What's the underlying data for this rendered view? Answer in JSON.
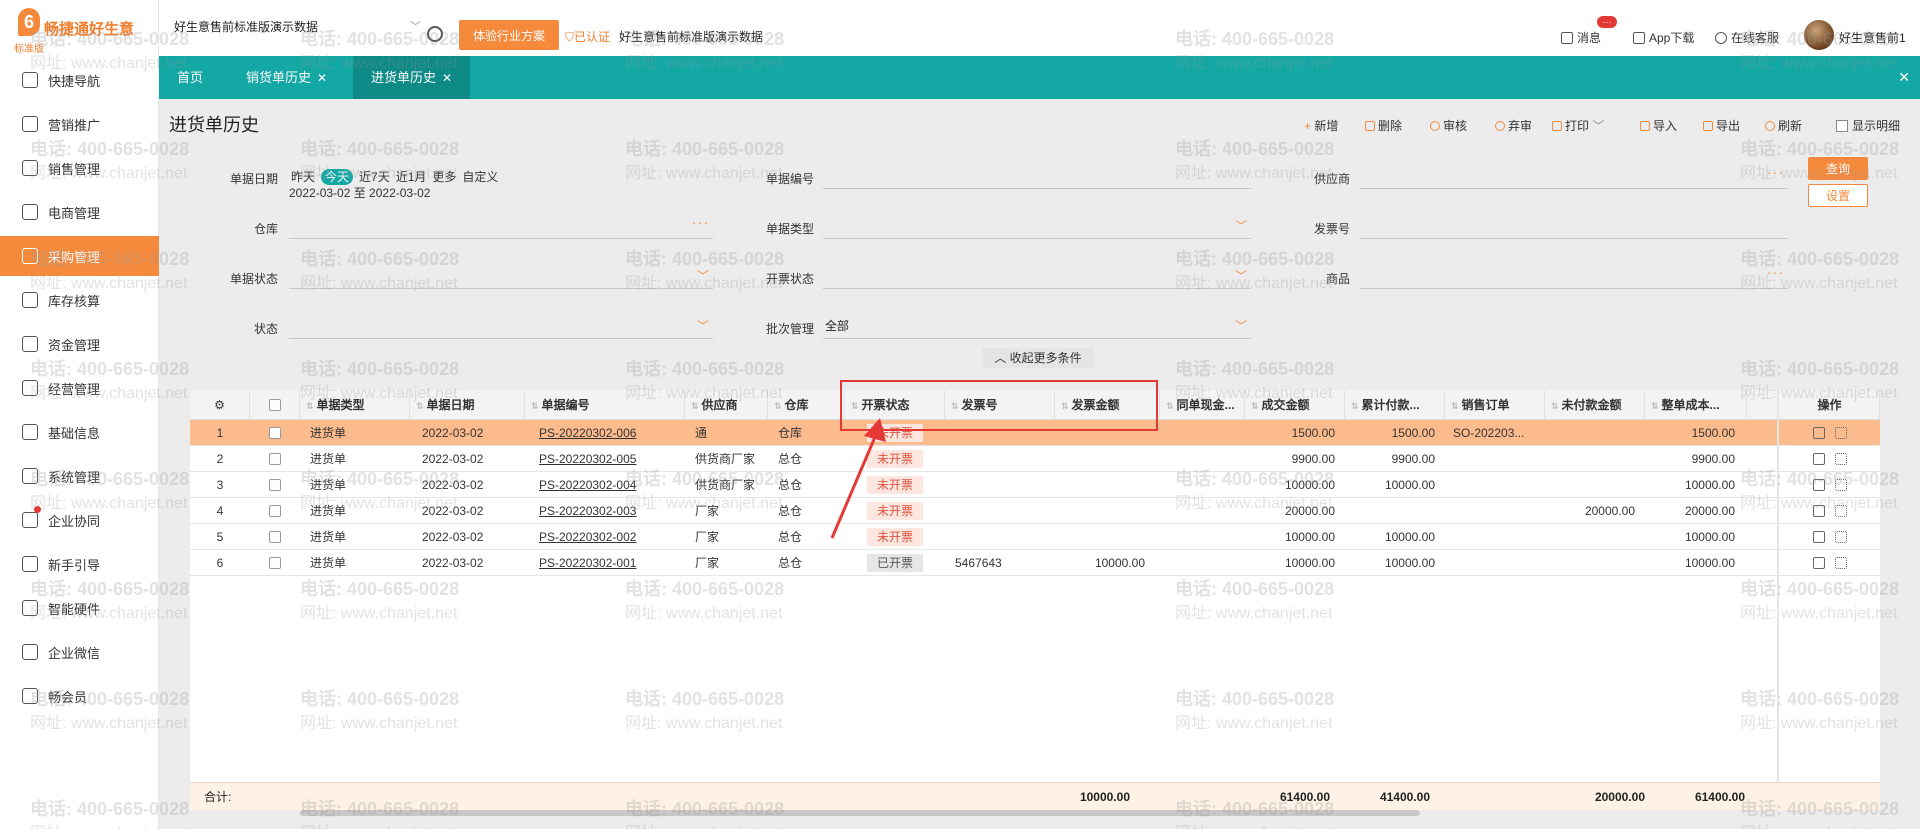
{
  "logo": {
    "brand": "畅捷通好生意",
    "edition": "标准版"
  },
  "sidebar": {
    "items": [
      {
        "label": "快捷导航",
        "icon": "compass-icon"
      },
      {
        "label": "营销推广",
        "icon": "gift-icon"
      },
      {
        "label": "销售管理",
        "icon": "tag-icon"
      },
      {
        "label": "电商管理",
        "icon": "store-icon"
      },
      {
        "label": "采购管理",
        "icon": "bag-icon",
        "active": true
      },
      {
        "label": "库存核算",
        "icon": "warehouse-icon"
      },
      {
        "label": "资金管理",
        "icon": "money-icon"
      },
      {
        "label": "经营管理",
        "icon": "clipboard-icon"
      },
      {
        "label": "基础信息",
        "icon": "id-card-icon"
      },
      {
        "label": "系统管理",
        "icon": "settings-icon"
      },
      {
        "label": "企业协同",
        "icon": "collab-icon",
        "badge": true
      },
      {
        "label": "新手引导",
        "icon": "guide-icon"
      },
      {
        "label": "智能硬件",
        "icon": "device-icon"
      },
      {
        "label": "企业微信",
        "icon": "wechat-icon"
      },
      {
        "label": "畅会员",
        "icon": "vip-icon"
      }
    ]
  },
  "topbar": {
    "account_name": "好生意售前标准版演示数据",
    "trial_button": "体验行业方案",
    "verified": "已认证",
    "company": "好生意售前标准版演示数据",
    "message": "消息",
    "message_badge": "···",
    "app_download": "App下载",
    "support": "在线客服",
    "username": "好生意售前1"
  },
  "tabs": [
    {
      "label": "首页",
      "closable": false
    },
    {
      "label": "销货单历史",
      "closable": true
    },
    {
      "label": "进货单历史",
      "closable": true,
      "active": true
    }
  ],
  "page": {
    "title": "进货单历史",
    "toolbar": {
      "add": "新增",
      "delete": "删除",
      "approve": "审核",
      "discard": "弃审",
      "print": "打印",
      "import": "导入",
      "export": "导出",
      "refresh": "刷新",
      "show_detail": "显示明细"
    }
  },
  "filter": {
    "doc_date_label": "单据日期",
    "quick_dates": [
      "昨天",
      "今天",
      "近7天",
      "近1月",
      "更多",
      "自定义"
    ],
    "quick_active": 1,
    "date_range": "2022-03-02 至 2022-03-02",
    "doc_no_label": "单据编号",
    "supplier_label": "供应商",
    "warehouse_label": "仓库",
    "doc_type_label": "单据类型",
    "invoice_no_label": "发票号",
    "doc_status_label": "单据状态",
    "invoice_status_label": "开票状态",
    "product_label": "商品",
    "status_label": "状态",
    "batch_label": "批次管理",
    "batch_value": "全部",
    "query": "查询",
    "settings": "设置",
    "collapse": "收起更多条件"
  },
  "grid": {
    "columns": [
      "单据类型",
      "单据日期",
      "单据编号",
      "供应商",
      "仓库",
      "开票状态",
      "发票号",
      "发票金额",
      "同单现金...",
      "成交金额",
      "累计付款...",
      "销售订单",
      "未付款金额",
      "整单成本...",
      "操作"
    ],
    "rows": [
      {
        "no": "1",
        "type": "进货单",
        "date": "2022-03-02",
        "code": "PS-20220302-006",
        "supplier": "通",
        "warehouse": "仓库",
        "invoice_status": "未开票",
        "invoice_no": "",
        "invoice_amt": "",
        "cash": "",
        "deal": "1500.00",
        "paid": "1500.00",
        "so": "SO-202203...",
        "unpaid": "",
        "cost": "1500.00"
      },
      {
        "no": "2",
        "type": "进货单",
        "date": "2022-03-02",
        "code": "PS-20220302-005",
        "supplier": "供货商厂家",
        "warehouse": "总仓",
        "invoice_status": "未开票",
        "invoice_no": "",
        "invoice_amt": "",
        "cash": "",
        "deal": "9900.00",
        "paid": "9900.00",
        "so": "",
        "unpaid": "",
        "cost": "9900.00"
      },
      {
        "no": "3",
        "type": "进货单",
        "date": "2022-03-02",
        "code": "PS-20220302-004",
        "supplier": "供货商厂家",
        "warehouse": "总仓",
        "invoice_status": "未开票",
        "invoice_no": "",
        "invoice_amt": "",
        "cash": "",
        "deal": "10000.00",
        "paid": "10000.00",
        "so": "",
        "unpaid": "",
        "cost": "10000.00"
      },
      {
        "no": "4",
        "type": "进货单",
        "date": "2022-03-02",
        "code": "PS-20220302-003",
        "supplier": "厂家",
        "warehouse": "总仓",
        "invoice_status": "未开票",
        "invoice_no": "",
        "invoice_amt": "",
        "cash": "",
        "deal": "20000.00",
        "paid": "",
        "so": "",
        "unpaid": "20000.00",
        "cost": "20000.00"
      },
      {
        "no": "5",
        "type": "进货单",
        "date": "2022-03-02",
        "code": "PS-20220302-002",
        "supplier": "厂家",
        "warehouse": "总仓",
        "invoice_status": "未开票",
        "invoice_no": "",
        "invoice_amt": "",
        "cash": "",
        "deal": "10000.00",
        "paid": "10000.00",
        "so": "",
        "unpaid": "",
        "cost": "10000.00"
      },
      {
        "no": "6",
        "type": "进货单",
        "date": "2022-03-02",
        "code": "PS-20220302-001",
        "supplier": "厂家",
        "warehouse": "总仓",
        "invoice_status": "已开票",
        "invoice_no": "5467643",
        "invoice_amt": "10000.00",
        "cash": "",
        "deal": "10000.00",
        "paid": "10000.00",
        "so": "",
        "unpaid": "",
        "cost": "10000.00"
      }
    ],
    "footer": {
      "label": "合计:",
      "invoice_amt": "10000.00",
      "deal": "61400.00",
      "paid": "41400.00",
      "unpaid": "20000.00",
      "cost": "61400.00"
    }
  },
  "watermark": {
    "phone": "电话: 400-665-0028",
    "site": "网址: www.chanjet.net"
  },
  "colors": {
    "accent": "#f58a3c",
    "teal": "#14a8a5",
    "annotation": "#e53935"
  }
}
